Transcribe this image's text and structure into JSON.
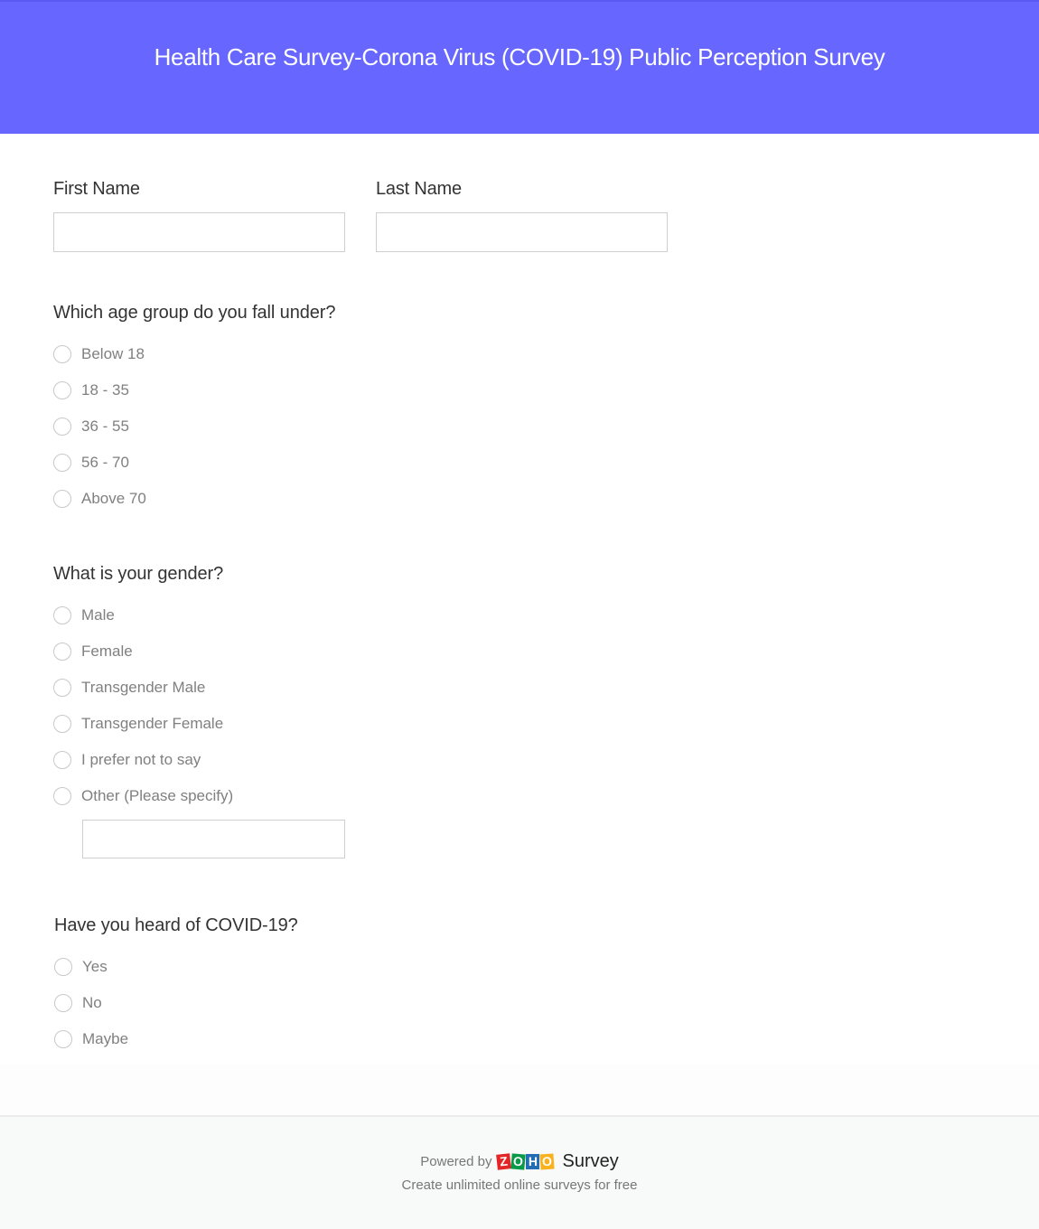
{
  "header": {
    "title": "Health Care Survey-Corona Virus (COVID-19) Public Perception Survey",
    "background": "#6767ff"
  },
  "name_fields": {
    "first_name": {
      "label": "First Name",
      "value": "",
      "placeholder": ""
    },
    "last_name": {
      "label": "Last Name",
      "value": "",
      "placeholder": ""
    }
  },
  "questions": [
    {
      "title": "Which age group do you fall under?",
      "options": [
        "Below 18",
        "18 - 35",
        "36 - 55",
        "56 - 70",
        "Above 70"
      ]
    },
    {
      "title": "What is your gender?",
      "options": [
        "Male",
        "Female",
        "Transgender Male",
        "Transgender Female",
        "I prefer not to say",
        "Other (Please specify)"
      ],
      "other_input": {
        "value": "",
        "placeholder": ""
      }
    },
    {
      "title": "Have you heard of COVID-19?",
      "options": [
        "Yes",
        "No",
        "Maybe"
      ]
    }
  ],
  "footer": {
    "powered_by": "Powered by",
    "logo_letters": [
      "Z",
      "O",
      "H",
      "O"
    ],
    "product": "Survey",
    "tagline": "Create unlimited online surveys for free"
  }
}
